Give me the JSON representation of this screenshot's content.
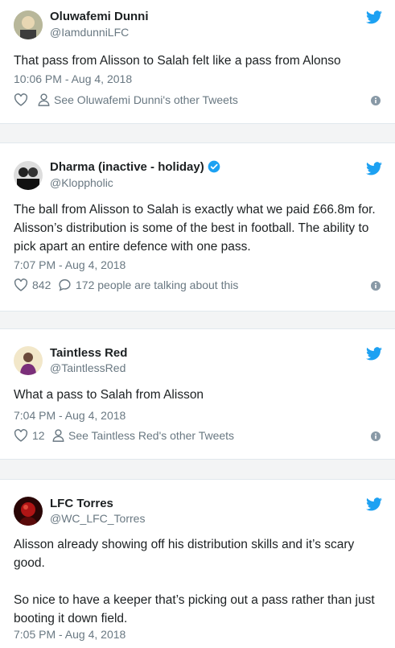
{
  "tweets": [
    {
      "name": "Oluwafemi Dunni",
      "handle": "@IamdunniLFC",
      "verified": false,
      "text": [
        "That pass from Alisson to  Salah felt like a pass from Alonso"
      ],
      "time": "10:06 PM - Aug 4, 2018",
      "likes": "",
      "action": "See Oluwafemi Dunni's other Tweets",
      "action_icon": "person-icon"
    },
    {
      "name": "Dharma (inactive - holiday)",
      "handle": "@Kloppholic",
      "verified": true,
      "text": [
        "The ball from Alisson to Salah is exactly what we paid £66.8m for. Alisson’s distribution is some of the best in football. The ability to pick apart an entire defence with one pass."
      ],
      "time": "7:07 PM - Aug 4, 2018",
      "likes": "842",
      "action": "172 people are talking about this",
      "action_icon": "reply-icon"
    },
    {
      "name": "Taintless Red",
      "handle": "@TaintlessRed",
      "verified": false,
      "text": [
        "What a pass to Salah from Alisson"
      ],
      "time": "7:04 PM - Aug 4, 2018",
      "likes": "12",
      "action": "See Taintless Red's other Tweets",
      "action_icon": "person-icon"
    },
    {
      "name": "LFC Torres",
      "handle": "@WC_LFC_Torres",
      "verified": false,
      "text": [
        "Alisson already showing off his distribution skills and it’s scary good.",
        "So nice to have a keeper that’s picking out a pass rather than just booting it down field."
      ],
      "time": "7:05 PM - Aug 4, 2018"
    }
  ],
  "colors": {
    "brand": "#1da1f2",
    "like": "#697882",
    "verified": "#1da1f2"
  }
}
